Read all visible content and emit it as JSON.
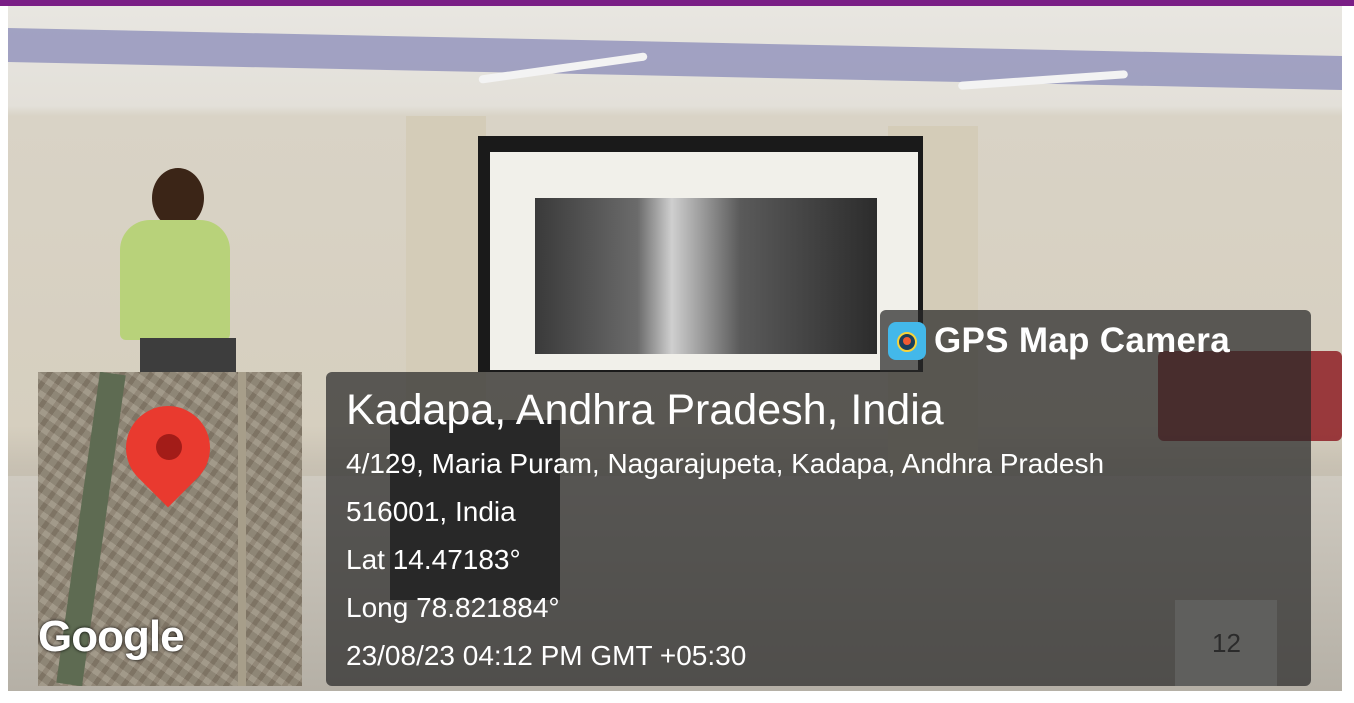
{
  "overlay": {
    "app_badge": "GPS Map Camera",
    "city": "Kadapa, Andhra Pradesh, India",
    "address_line1": "4/129, Maria Puram, Nagarajupeta, Kadapa, Andhra Pradesh",
    "address_line2": "516001, India",
    "latitude": "Lat 14.47183°",
    "longitude": "Long 78.821884°",
    "timestamp": "23/08/23 04:12 PM GMT +05:30"
  },
  "map": {
    "provider_label": "Google"
  },
  "scene": {
    "card_number": "12"
  },
  "colors": {
    "top_bar": "#7a1e86",
    "pin": "#e93a2f",
    "overlay_bg": "rgba(40,40,40,0.72)",
    "overlay_text": "#ffffff"
  },
  "icons": [
    "gps-map-camera-icon",
    "map-pin-icon"
  ]
}
